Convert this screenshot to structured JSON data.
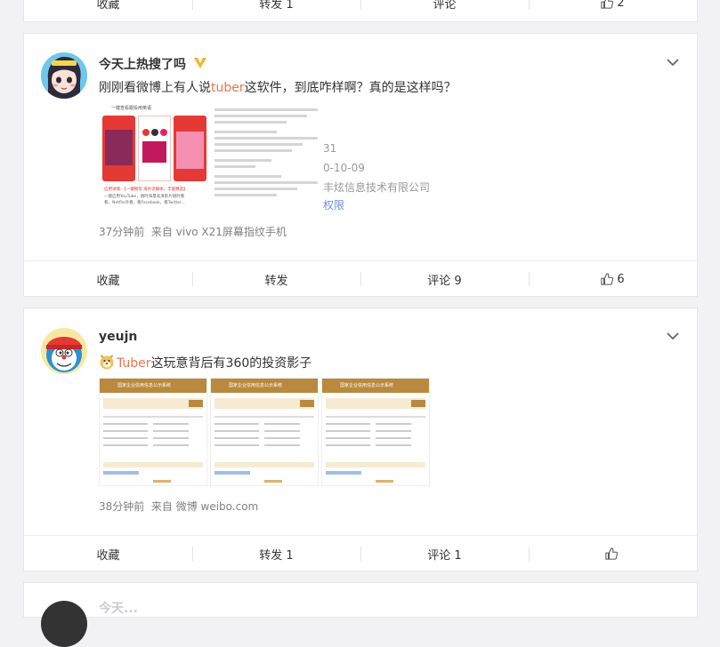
{
  "top_bar": {
    "collect": "收藏",
    "repost": "转发 1",
    "comment": "评论",
    "like": "2"
  },
  "post1": {
    "username": "今天上热搜了吗",
    "text_before": "刚刚看微博上有人说",
    "text_link": "tuber",
    "text_after": "这软件，到底咋样啊？真的是这样吗？",
    "image_lines": {
      "banner": "一键查看跟投用英语",
      "btn1": "一键查看",
      "btn2": "找查看看",
      "caption1": "应用详情：【一键畅玩 海外流媒体，丰富精选】",
      "caption2": "一键启用YouTube，随时海量高清影片随时看",
      "caption3": "看，Netflix外看，看Facebook，看Twitter...",
      "year": "31",
      "date": "0-10-09",
      "company": "丰炫信息技术有限公司",
      "perm": "权限"
    },
    "meta": "37分钟前  来自 vivo X21屏幕指纹手机",
    "actions": {
      "collect": "收藏",
      "repost": "转发",
      "comment": "评论 9",
      "like": "6"
    },
    "colors": {
      "accent": "#eb7350",
      "verified": "#f6b322"
    }
  },
  "post2": {
    "username": "yeujn",
    "emoji_icon": "doge-emoji-icon",
    "text_link": "Tuber",
    "text_after": "这玩意背后有360的投资影子",
    "image_header": "国家企业信用信息公示系统",
    "meta": "38分钟前  来自 微博 weibo.com",
    "actions": {
      "collect": "收藏",
      "repost": "转发 1",
      "comment": "评论 1",
      "like": ""
    }
  },
  "post3": {
    "username": "今天..."
  }
}
